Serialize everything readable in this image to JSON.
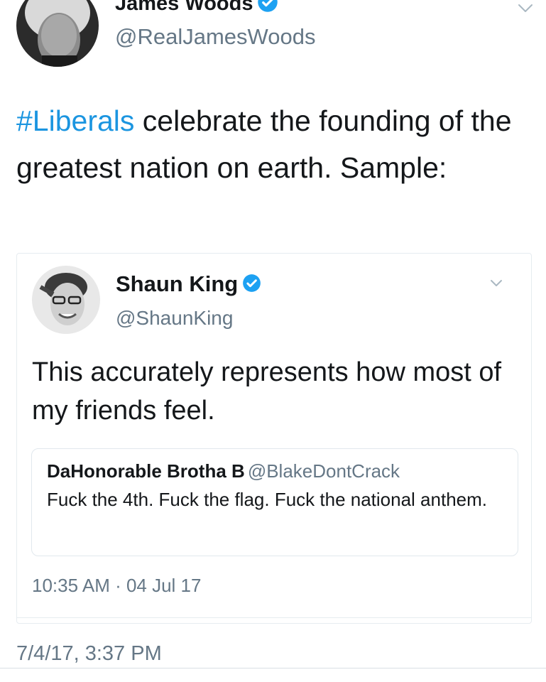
{
  "tweet": {
    "author": {
      "display_name": "James Woods",
      "handle": "@RealJamesWoods",
      "verified": true
    },
    "text": {
      "hashtag": "#Liberals",
      "rest": " celebrate the founding of the greatest nation on earth. Sample:"
    },
    "timestamp": "7/4/17, 3:37 PM",
    "menu_icon": "chevron-down-icon"
  },
  "quoted_tweet": {
    "author": {
      "display_name": "Shaun King",
      "handle": "@ShaunKing",
      "verified": true
    },
    "text": "This accurately represents how most of my friends feel.",
    "timestamp": "10:35 AM · 04 Jul 17",
    "menu_icon": "chevron-down-icon",
    "nested_quote": {
      "display_name": "DaHonorable Brotha B",
      "handle": "@BlakeDontCrack",
      "text": "Fuck the 4th. Fuck the flag. Fuck the national anthem."
    }
  },
  "colors": {
    "link_blue": "#1b95e0",
    "verified_blue": "#1da1f2",
    "text_primary": "#14171a",
    "text_secondary": "#657786",
    "border": "#e6ecf0"
  }
}
